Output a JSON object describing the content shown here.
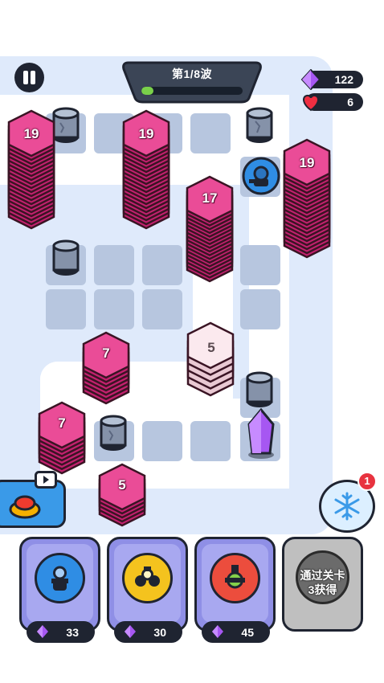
{
  "wave": {
    "label": "第1/8波",
    "progress": 0.12
  },
  "resources": {
    "gems": "122",
    "lives": "6"
  },
  "stacks": [
    {
      "id": "stack-1",
      "count": "19"
    },
    {
      "id": "stack-2",
      "count": "19"
    },
    {
      "id": "stack-3",
      "count": "17"
    },
    {
      "id": "stack-4",
      "count": "19"
    },
    {
      "id": "stack-5",
      "count": "5"
    },
    {
      "id": "stack-6",
      "count": "7"
    },
    {
      "id": "stack-7",
      "count": "7"
    },
    {
      "id": "stack-8",
      "count": "5"
    }
  ],
  "towers": [
    {
      "name": "blue-tower",
      "price": "33",
      "color": "#2f8de4"
    },
    {
      "name": "yellow-tower",
      "price": "30",
      "color": "#f4c31e"
    },
    {
      "name": "red-tower",
      "price": "45",
      "color": "#ec4d3d"
    }
  ],
  "locked_slot": {
    "line1": "通过关卡",
    "line2": "3获得"
  },
  "freeze": {
    "badge": "1"
  },
  "colors": {
    "accent": "#e23c8c",
    "gem": "#a657f2",
    "board": "#dfeafb",
    "tile": "#b7c6df"
  }
}
